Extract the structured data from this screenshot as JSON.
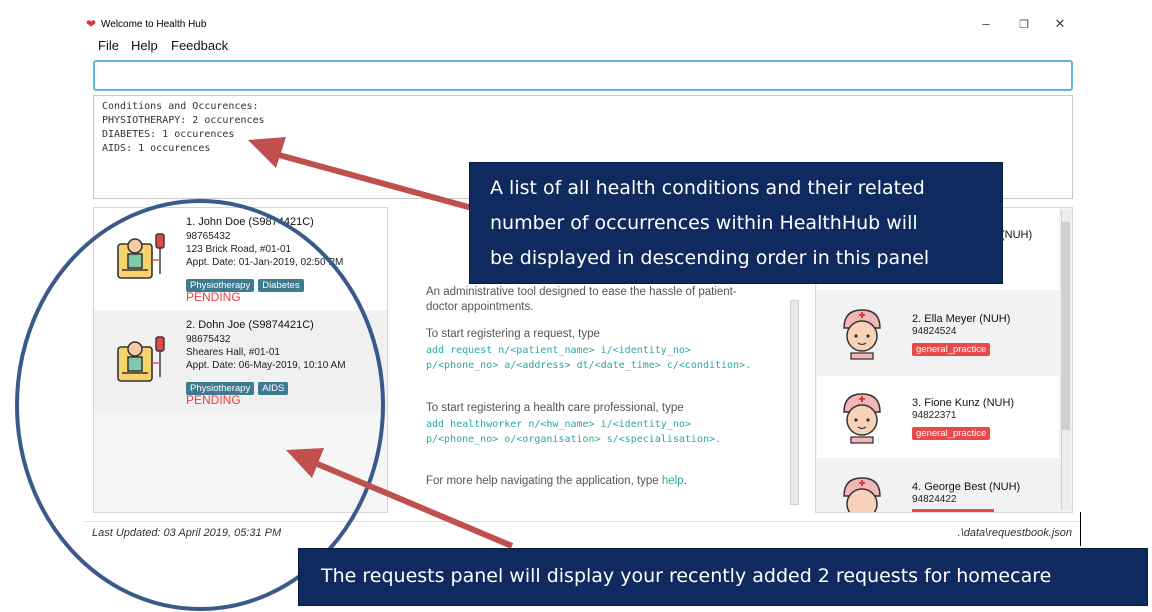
{
  "window": {
    "title": "Welcome to Health Hub",
    "icon": "heart-icon"
  },
  "menu": [
    "File",
    "Help",
    "Feedback"
  ],
  "command": {
    "value": ""
  },
  "result": [
    "Conditions and Occurences:",
    "PHYSIOTHERAPY: 2 occurences",
    "DIABETES: 1 occurences",
    "AIDS: 1 occurences"
  ],
  "requests": [
    {
      "title": "1.  John Doe  (S9874421C)",
      "phone": "98765432",
      "address": "123 Brick Road, #01-01",
      "date": "Appt. Date: 01-Jan-2019, 02:50 PM",
      "tags": [
        "Physiotherapy",
        "Diabetes"
      ],
      "status": "PENDING"
    },
    {
      "title": "2.  Dohn Joe  (S9874421C)",
      "phone": "98675432",
      "address": "Sheares Hall, #01-01",
      "date": "Appt. Date: 06-May-2019, 10:10 AM",
      "tags": [
        "Physiotherapy",
        "AIDS"
      ],
      "status": "PENDING"
    }
  ],
  "help": {
    "intro": "An administrative tool designed to ease the hassle of patient-",
    "intro2": "doctor appointments.",
    "req_label": "To start registering a request, type",
    "req_code1": "add request n/<patient_name> i/<identity_no>",
    "req_code2": "p/<phone_no> a/<address> dt/<date_time> c/<condition>.",
    "hw_label": "To start registering a health care professional, type",
    "hw_code1": "add healthworker n/<hw_name> i/<identity_no>",
    "hw_code2": "p/<phone_no> o/<organisation> s/<specialisation>.",
    "more": "For more help navigating the application, type ",
    "more_cmd": "help",
    "more_end": "."
  },
  "workers": [
    {
      "name_tail": "(NUH)",
      "phone": "",
      "tag": ""
    },
    {
      "name": "2.  Ella Meyer  (NUH)",
      "phone": "94824524",
      "tag": "general_practice"
    },
    {
      "name": "3.  Fione Kunz  (NUH)",
      "phone": "94822371",
      "tag": "general_practice"
    },
    {
      "name": "4.  George Best  (NUH)",
      "phone": "94824422",
      "tag": ""
    }
  ],
  "status": {
    "last_updated": "Last Updated: 03 April 2019, 05:31 PM",
    "file": ".\\data\\requestbook.json"
  },
  "annotations": {
    "top": [
      "A list of all health conditions and their related",
      "number of occurrences within HealthHub will",
      "be displayed in descending order in this panel"
    ],
    "bottom": "The requests panel will display your recently added 2 requests for homecare"
  },
  "colors": {
    "tag": "#3e7b91",
    "pending": "#ef3c3c",
    "worker_tag": "#e84a4a",
    "callout": "#0f2a5e",
    "arrow": "#c0504d",
    "circle": "#3b5a8c"
  }
}
